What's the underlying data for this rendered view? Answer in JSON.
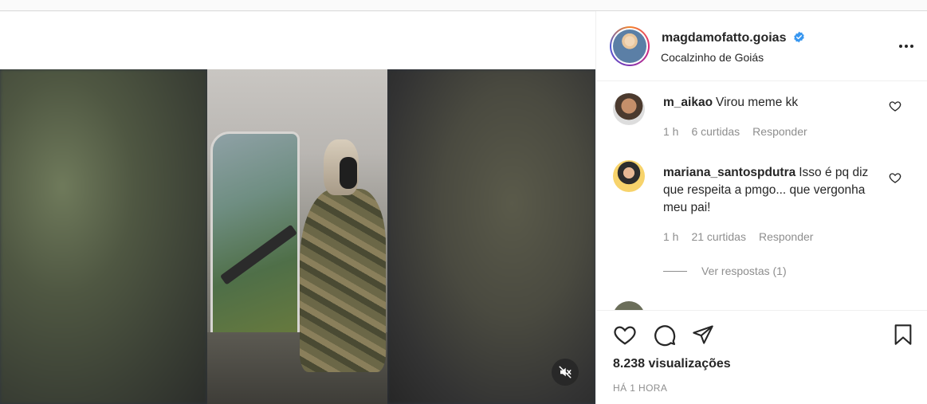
{
  "post": {
    "username": "magdamofatto.goias",
    "verified": true,
    "location": "Cocalzinho de Goiás",
    "views_count": "8.238",
    "views_label": "visualizações",
    "time_ago": "HÁ 1 HORA"
  },
  "comments": [
    {
      "user": "m_aikao",
      "text": "Virou meme kk",
      "time": "1 h",
      "likes": "6 curtidas",
      "reply_label": "Responder"
    },
    {
      "user": "mariana_santospdutra",
      "text": "Isso é pq diz que respeita a pmgo... que vergonha meu pai!",
      "time": "1 h",
      "likes": "21 curtidas",
      "reply_label": "Responder",
      "view_replies": "Ver respostas (1)"
    }
  ],
  "icons": {
    "more": "more-options-icon",
    "verified": "verified-badge-icon",
    "mute": "volume-muted-icon",
    "like": "heart-icon",
    "comment": "comment-icon",
    "share": "share-icon",
    "save": "bookmark-icon"
  },
  "colors": {
    "verified_blue": "#3897f0",
    "text_primary": "#262626",
    "text_secondary": "#8e8e8e"
  }
}
